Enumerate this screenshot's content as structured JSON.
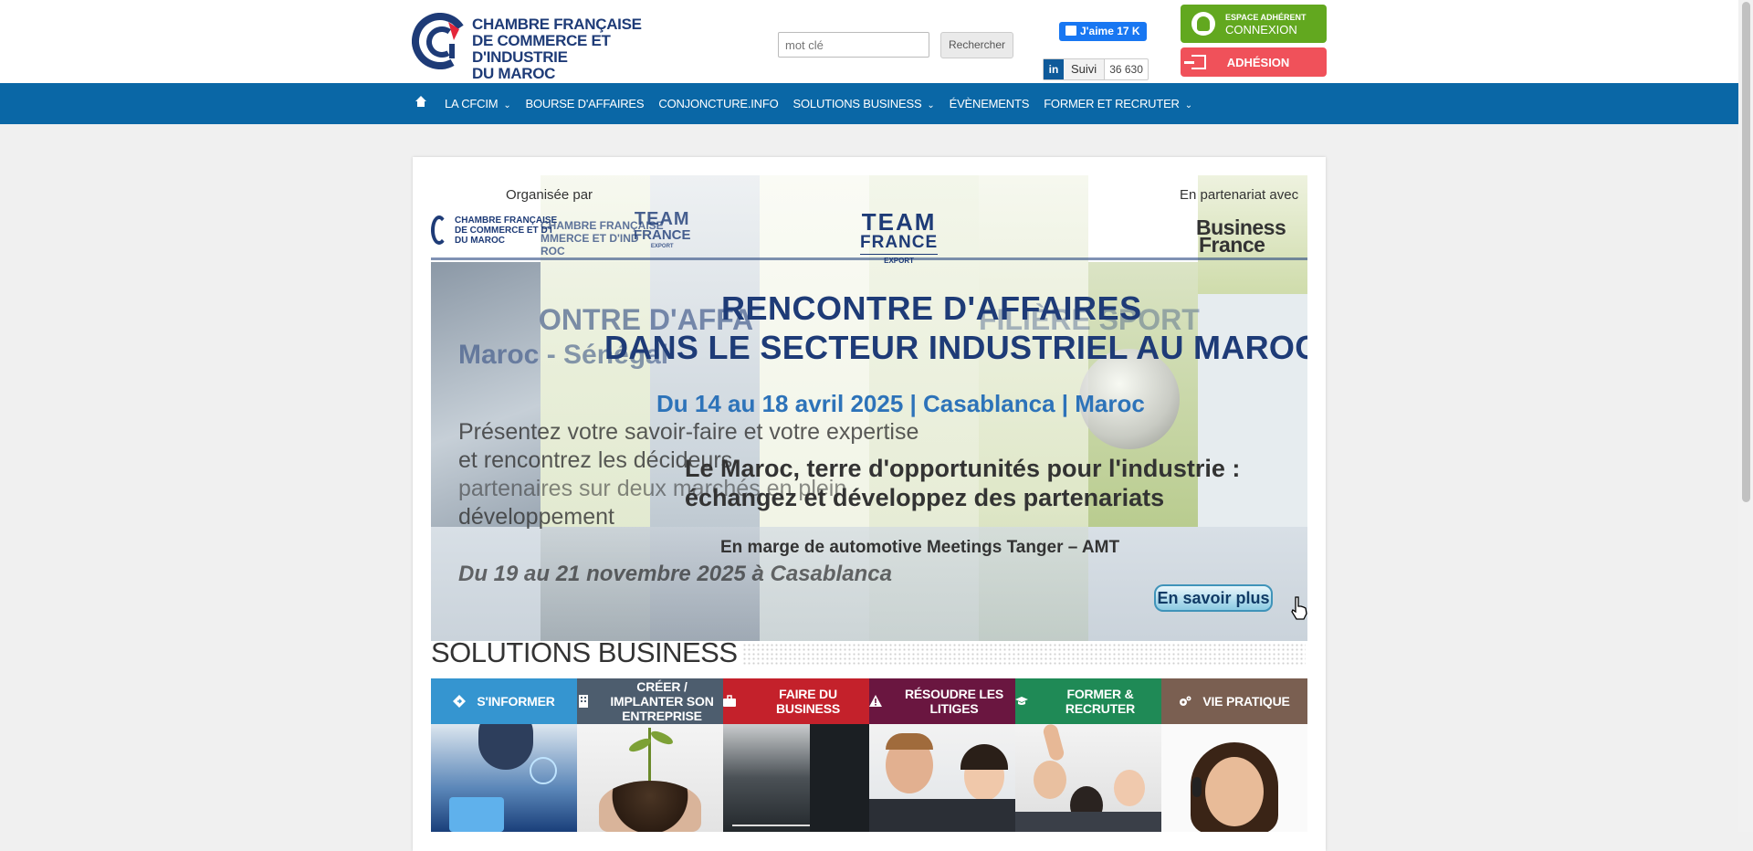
{
  "header": {
    "logo_lines": [
      "CHAMBRE FRANÇAISE",
      "DE COMMERCE ET D'INDUSTRIE",
      "DU MAROC"
    ],
    "search_placeholder": "mot clé",
    "search_button": "Rechercher",
    "facebook_like": "J'aime 17 K",
    "linkedin_in": "in",
    "linkedin_follow": "Suivi",
    "linkedin_count": "36 630",
    "espace_small": "ESPACE ADHÉRENT",
    "espace_big": "CONNEXION",
    "adhesion": "ADHÉSION"
  },
  "nav": {
    "items": [
      {
        "label": "LA CFCIM"
      },
      {
        "label": "BOURSE D'AFFAIRES"
      },
      {
        "label": "CONJONCTURE.INFO"
      },
      {
        "label": "SOLUTIONS BUSINESS"
      },
      {
        "label": "ÉVÈNEMENTS"
      },
      {
        "label": "FORMER ET RECRUTER"
      }
    ],
    "chevron": "⌄"
  },
  "slider": {
    "organisee_par": "Organisée par",
    "en_partenariat": "En partenariat avec",
    "org_logo": [
      "CHAMBRE FRANÇAISE",
      "DE COMMERCE ET D'I",
      "DU MAROC"
    ],
    "org_logo_ghost": [
      "CHAMBRE FRANÇAISE",
      "MMERCE ET D'IND",
      "ROC"
    ],
    "team": "TEAM",
    "france": "FRANCE",
    "export": "EXPORT",
    "business_france": [
      "Business",
      "France"
    ],
    "title_line1": "RENCONTRE D'AFFAIRES",
    "title_line2": "DANS LE SECTEUR INDUSTRIEL AU MAROC",
    "ghost_title": "ONTRE D'AFFA",
    "ghost_sport": "FILIÈRE SPORT",
    "ghost_senegal": "Maroc - Sénégal",
    "dates": "Du 14 au 18 avril 2025 | Casablanca | Maroc",
    "tagline_line1": "Le Maroc, terre d'opportunités pour l'industrie :",
    "tagline_line2": "échangez et développez des partenariats",
    "ghost_para": [
      "Présentez votre savoir-faire et votre expertise",
      "et rencontrez les décideurs",
      "partenaires sur deux marchés en plein",
      "développement"
    ],
    "amt": "En marge de automotive Meetings Tanger – AMT",
    "ghost_date": "Du 19 au 21 novembre 2025 à Casablanca",
    "cta": "En savoir plus"
  },
  "solutions": {
    "title": "SOLUTIONS BUSINESS",
    "categories": [
      {
        "label": "S'INFORMER",
        "color": "#3595d0",
        "icon": "diamond-arrow-icon"
      },
      {
        "label": "CRÉER / IMPLANTER SON ENTREPRISE",
        "color": "#4d5d6e",
        "icon": "building-icon"
      },
      {
        "label": "FAIRE DU BUSINESS",
        "color": "#c4212b",
        "icon": "briefcase-icon"
      },
      {
        "label": "RÉSOUDRE LES LITIGES",
        "color": "#6a1640",
        "icon": "warning-icon"
      },
      {
        "label": "FORMER & RECRUTER",
        "color": "#1f8a56",
        "icon": "graduation-cap-icon"
      },
      {
        "label": "VIE PRATIQUE",
        "color": "#7a5f51",
        "icon": "cogs-icon"
      }
    ]
  },
  "colors": {
    "nav": "#0a67a6",
    "espace": "#62a81f",
    "adhesion": "#f0515a",
    "brand_navy": "#1e3b77",
    "brand_red": "#e4263a"
  }
}
